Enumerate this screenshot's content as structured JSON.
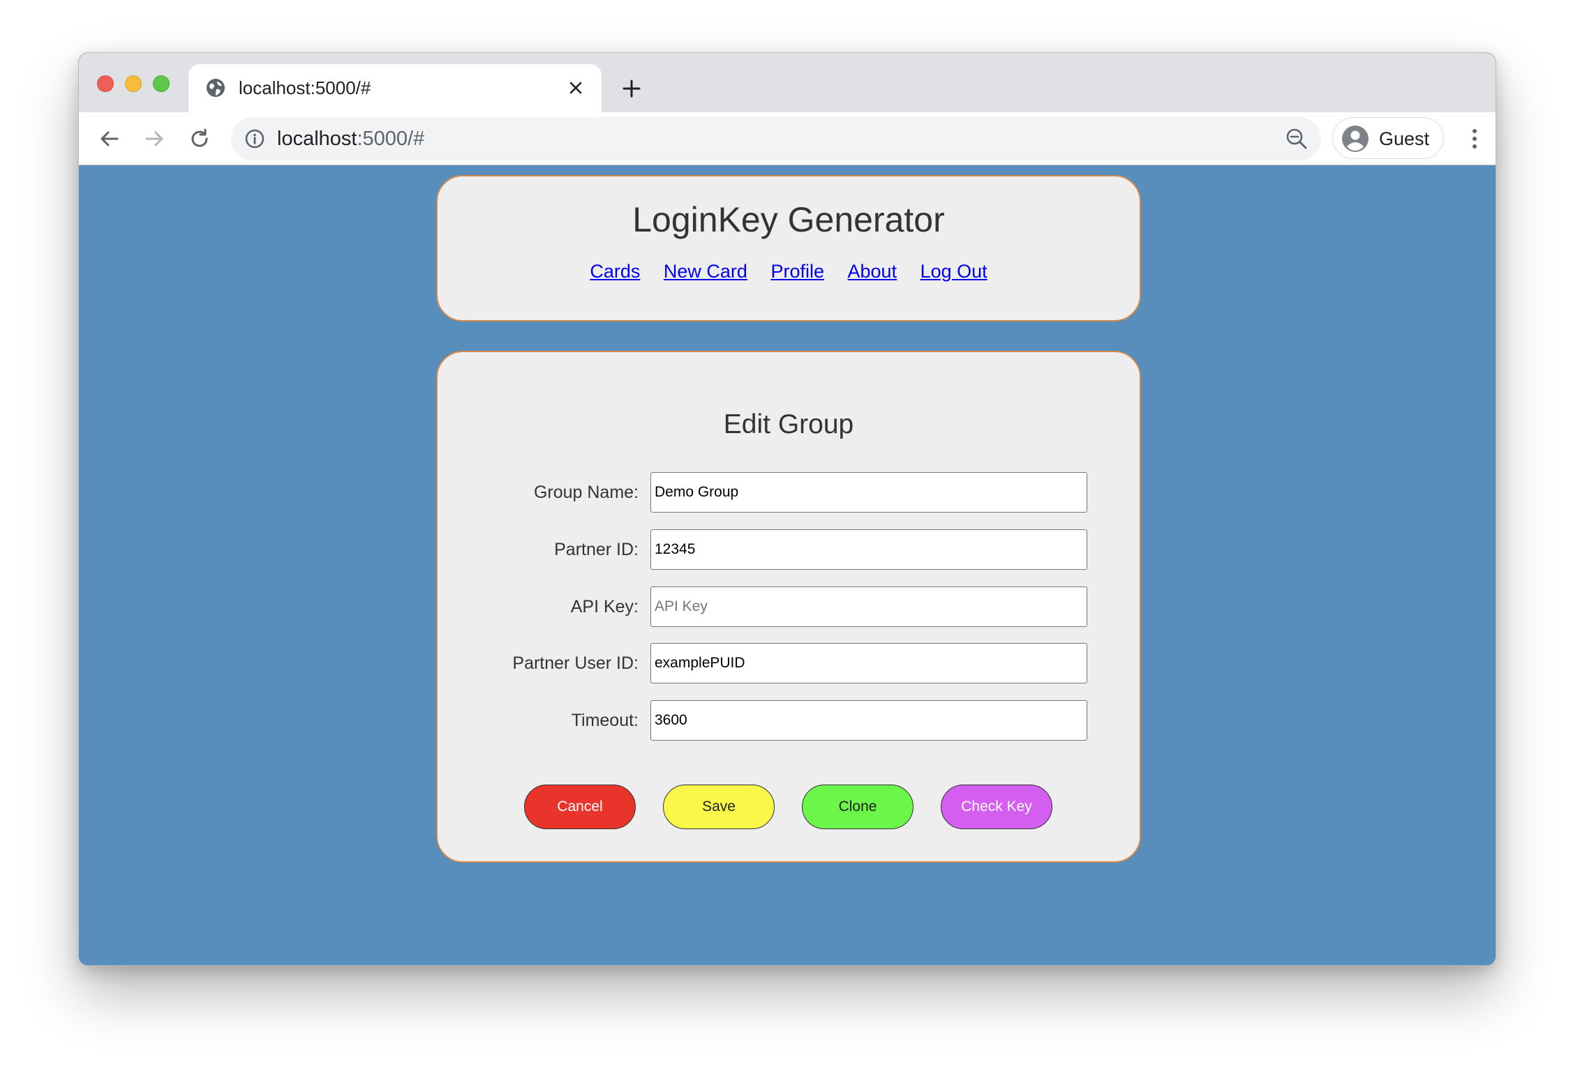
{
  "browser": {
    "tab_title": "localhost:5000/#",
    "url_host": "localhost",
    "url_rest": ":5000/#",
    "profile_name": "Guest"
  },
  "header": {
    "title": "LoginKey Generator",
    "nav": [
      {
        "label": "Cards"
      },
      {
        "label": "New Card"
      },
      {
        "label": "Profile"
      },
      {
        "label": "About"
      },
      {
        "label": "Log Out"
      }
    ]
  },
  "form": {
    "title": "Edit Group",
    "fields": [
      {
        "label": "Group Name:",
        "value": "Demo Group",
        "placeholder": ""
      },
      {
        "label": "Partner ID:",
        "value": "12345",
        "placeholder": ""
      },
      {
        "label": "API Key:",
        "value": "",
        "placeholder": "API Key"
      },
      {
        "label": "Partner User ID:",
        "value": "examplePUID",
        "placeholder": ""
      },
      {
        "label": "Timeout:",
        "value": "3600",
        "placeholder": ""
      }
    ],
    "buttons": {
      "cancel": "Cancel",
      "save": "Save",
      "clone": "Clone",
      "check_key": "Check Key"
    }
  },
  "colors": {
    "page_background": "#578ebc",
    "card_background": "#eeeeee",
    "card_border": "#d58a4c",
    "link": "#0000ee",
    "cancel": "#e8342a",
    "save": "#f9f84a",
    "clone": "#6cf64a",
    "check_key": "#d45ef0"
  },
  "icons": {
    "tab_favicon": "globe-icon",
    "tab_close": "close-icon",
    "new_tab": "plus-icon",
    "back": "arrow-left-icon",
    "forward": "arrow-right-icon",
    "reload": "reload-icon",
    "site_info": "info-icon",
    "zoom": "zoom-out-icon",
    "avatar": "person-icon",
    "menu": "kebab-menu-icon"
  }
}
